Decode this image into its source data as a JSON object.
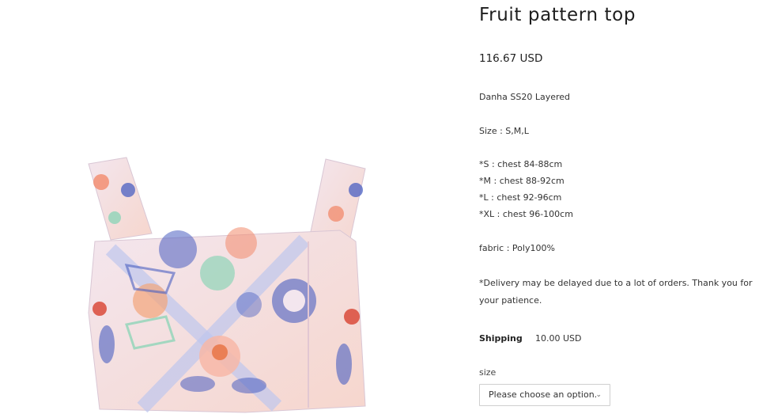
{
  "product": {
    "title": "Fruit pattern top",
    "price": "116.67 USD",
    "collection": "Danha SS20 Layered",
    "sizes": "Size : S,M,L",
    "size_chart": [
      "*S : chest 84-88cm",
      "*M : chest 88-92cm",
      "*L : chest 92-96cm",
      "*XL : chest 96-100cm"
    ],
    "fabric": "fabric : Poly100%",
    "delivery_notice": "*Delivery may be delayed due to a lot of orders. Thank you for your patience.",
    "image_icon": "product-photo"
  },
  "shipping": {
    "label": "Shipping",
    "value": "10.00 USD"
  },
  "size_select": {
    "label": "size",
    "placeholder": "Please choose an option.",
    "chevron_icon": "chevron-down-icon"
  },
  "colors": {
    "pink": "#f4c9c0",
    "blue": "#4a5fc1",
    "mint": "#8fd4b8",
    "coral": "#e8703f"
  }
}
